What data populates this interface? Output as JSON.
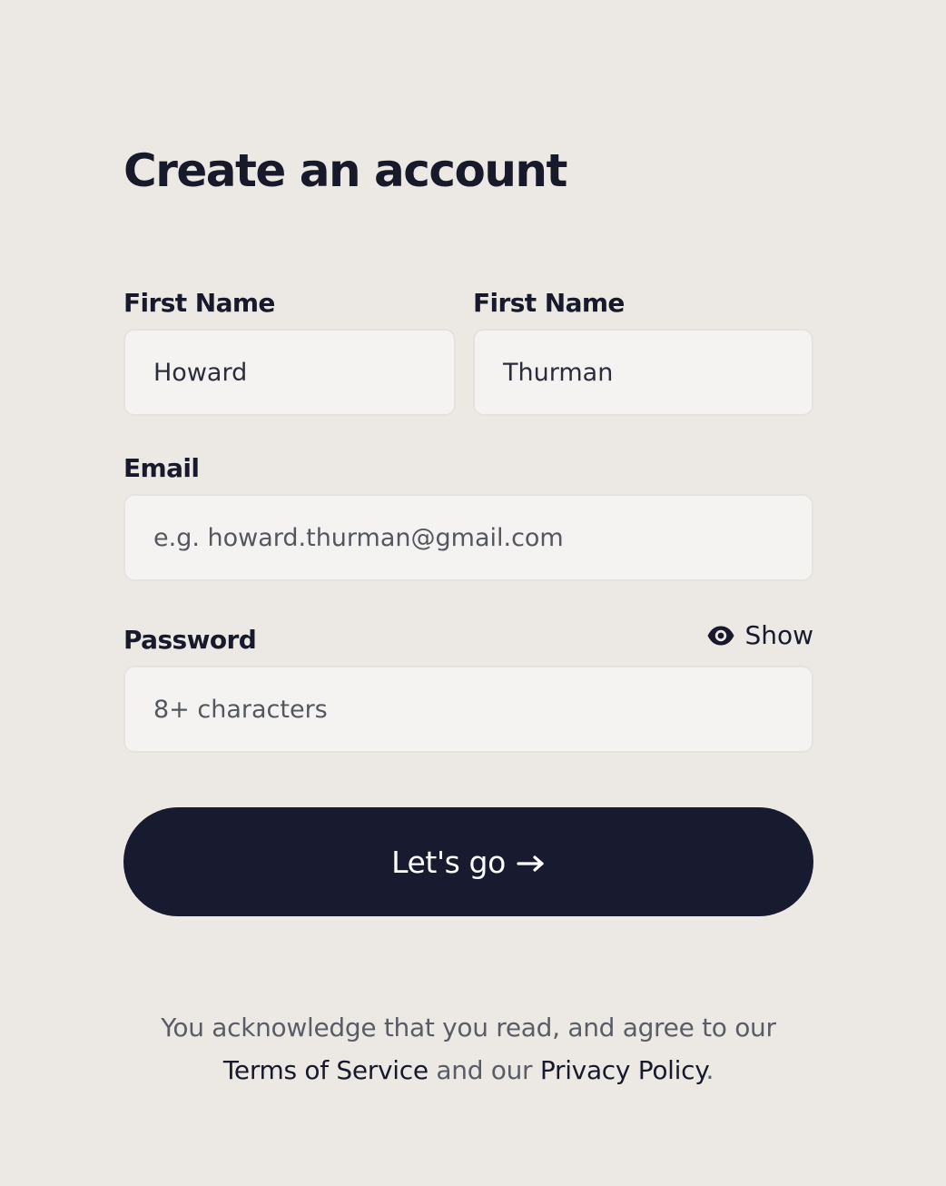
{
  "form": {
    "title": "Create an account",
    "first_name": {
      "label": "First Name",
      "value": "Howard"
    },
    "last_name": {
      "label": "First Name",
      "value": "Thurman"
    },
    "email": {
      "label": "Email",
      "placeholder": "e.g. howard.thurman@gmail.com",
      "value": ""
    },
    "password": {
      "label": "Password",
      "placeholder": "8+ characters",
      "value": "",
      "toggle_label": "Show",
      "toggle_icon": "eye-icon"
    },
    "submit": {
      "label": "Let's go",
      "icon": "arrow-right-icon"
    },
    "legal": {
      "text_before": "You acknowledge that you read, and agree to our",
      "terms_link": "Terms of Service",
      "text_middle": "and our",
      "privacy_link": "Privacy Policy",
      "text_after": "."
    }
  },
  "colors": {
    "background": "#ece9e5",
    "field_background": "#f4f3f2",
    "primary": "#181a2f",
    "text_dark": "#181a2c",
    "text_muted": "#5a5c66"
  }
}
